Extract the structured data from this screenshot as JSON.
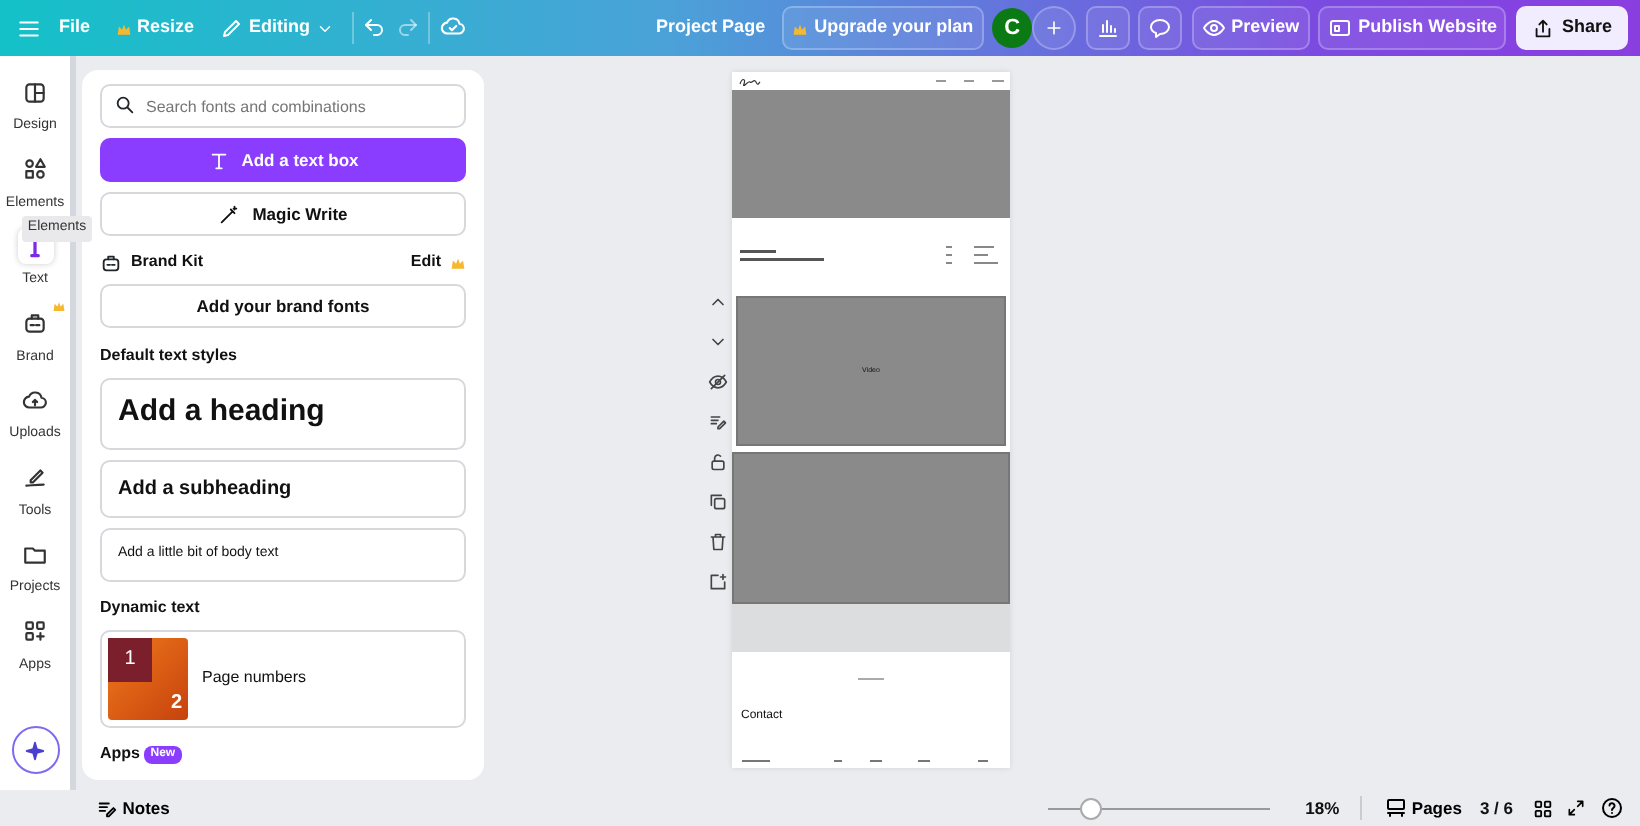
{
  "topbar": {
    "menu_items": [
      {
        "label": "File",
        "crown": false
      },
      {
        "label": "Resize",
        "crown": true
      },
      {
        "label": "Editing",
        "crown": false
      }
    ],
    "project_title": "Project Page",
    "upgrade": "Upgrade your plan",
    "avatar": "C",
    "preview": "Preview",
    "publish": "Publish Website",
    "share": "Share"
  },
  "rail": {
    "items": [
      {
        "label": "Design",
        "selected": false,
        "crown": false
      },
      {
        "label": "Elements",
        "selected": false,
        "crown": false
      },
      {
        "label": "Text",
        "selected": true,
        "crown": false
      },
      {
        "label": "Brand",
        "selected": false,
        "crown": true
      },
      {
        "label": "Uploads",
        "selected": false,
        "crown": false
      },
      {
        "label": "Tools",
        "selected": false,
        "crown": false
      },
      {
        "label": "Projects",
        "selected": false,
        "crown": false
      },
      {
        "label": "Apps",
        "selected": false,
        "crown": false
      }
    ],
    "tooltip": "Elements"
  },
  "panel": {
    "search": {
      "placeholder": "Search fonts and combinations"
    },
    "add_text_box": "Add a text box",
    "magic_write": "Magic Write",
    "brand_kit": {
      "label": "Brand Kit",
      "edit": "Edit",
      "add_fonts": "Add your brand fonts"
    },
    "default_title": "Default text styles",
    "styles": [
      {
        "kind": "heading",
        "label": "Add a heading"
      },
      {
        "kind": "subheading",
        "label": "Add a subheading"
      },
      {
        "kind": "body",
        "label": "Add a little bit of body text"
      }
    ],
    "dynamic_title": "Dynamic text",
    "dynamic_items": [
      {
        "label": "Page numbers",
        "thumb": [
          "1",
          "2"
        ]
      }
    ],
    "apps_title": "Apps",
    "apps_badge": "New"
  },
  "page": {
    "video_label": "Video",
    "contact": "Contact"
  },
  "bottom": {
    "notes": "Notes",
    "zoom": {
      "level": 0.19
    },
    "zoom_reading": "18%",
    "pages": "Pages",
    "page_count": "3 / 6"
  }
}
